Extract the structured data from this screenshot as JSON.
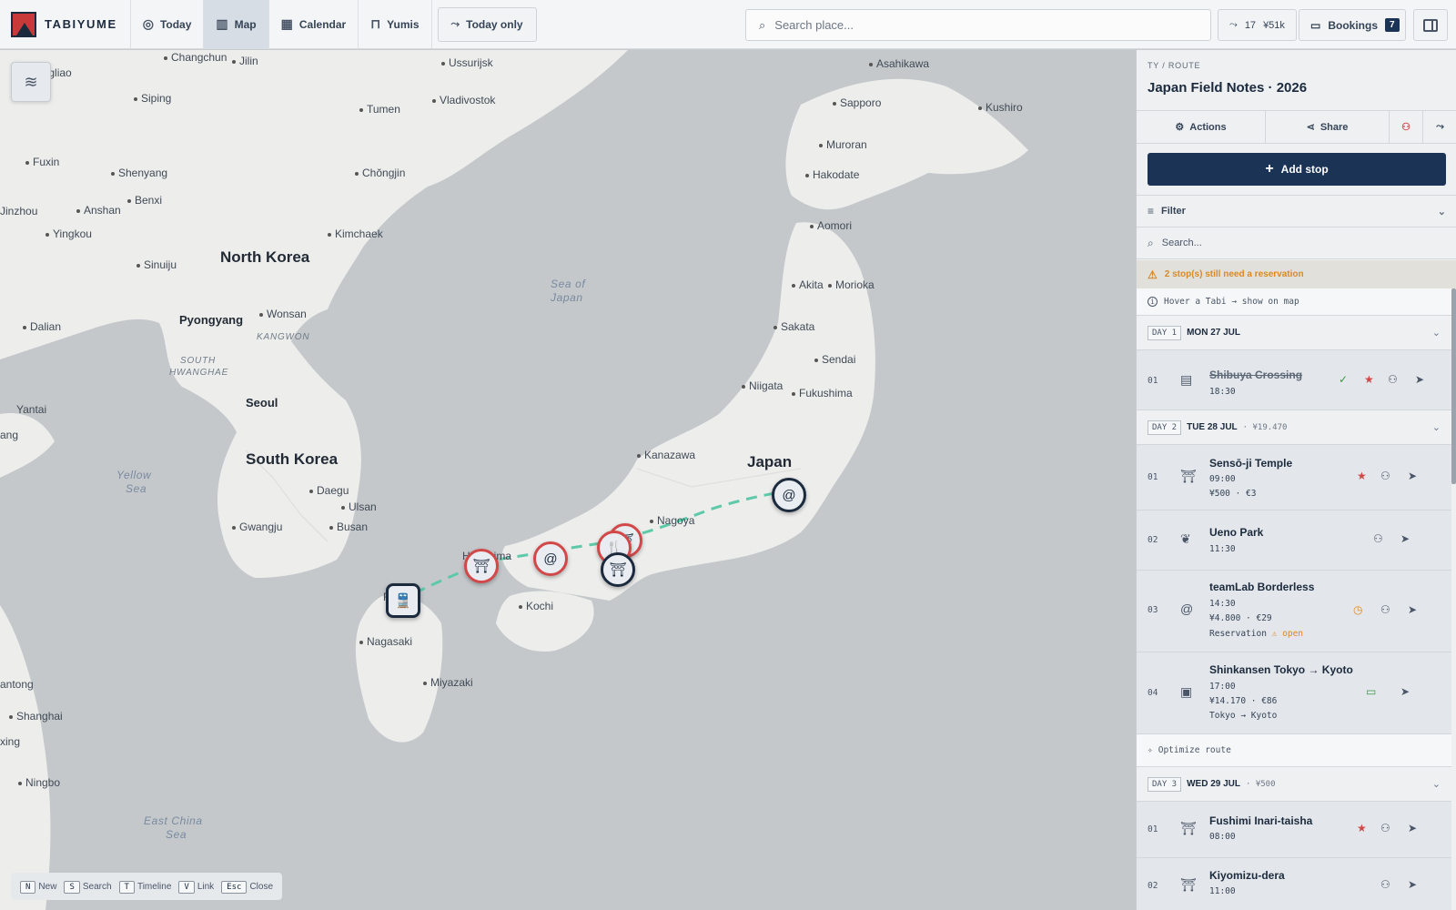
{
  "app": {
    "brand": "TABIYUME"
  },
  "nav": {
    "tabs": [
      {
        "label": "Today"
      },
      {
        "label": "Map"
      },
      {
        "label": "Calendar"
      },
      {
        "label": "Yumis"
      }
    ],
    "today_only": "Today only"
  },
  "search": {
    "placeholder": "Search place..."
  },
  "stats": {
    "stops": "17",
    "budget": "¥51k"
  },
  "bookings": {
    "label": "Bookings",
    "count": "7"
  },
  "map": {
    "labels": {
      "yongliao": "ongliao",
      "changchun": "Changchun",
      "jilin": "Jilin",
      "ussurijsk": "Ussurijsk",
      "asahikawa": "Asahikawa",
      "siping": "Siping",
      "vladivostok": "Vladivostok",
      "sapporo": "Sapporo",
      "kushiro": "Kushiro",
      "tumen": "Tumen",
      "muroran": "Muroran",
      "fuxin": "Fuxin",
      "shenyang": "Shenyang",
      "chongjin": "Chŏngjin",
      "hakodate": "Hakodate",
      "benxi": "Benxi",
      "jinzhou": "Jinzhou",
      "anshan": "Anshan",
      "aomori": "Aomori",
      "yingkou": "Yingkou",
      "kimchaek": "Kimchaek",
      "north_korea": "North Korea",
      "sinuiju": "Sinuiju",
      "sea_of_japan_1": "Sea of",
      "sea_of_japan_2": "Japan",
      "akita": "Akita",
      "morioka": "Morioka",
      "dalian": "Dalian",
      "pyongyang": "Pyongyang",
      "wonsan": "Wonsan",
      "sakata": "Sakata",
      "kangwon": "KANGWON",
      "south_hwanghae_1": "SOUTH",
      "south_hwanghae_2": "HWANGHAE",
      "sendai": "Sendai",
      "niigata": "Niigata",
      "seoul": "Seoul",
      "fukushima": "Fukushima",
      "yantai": "Yantai",
      "weifang": "ang",
      "kanazawa": "Kanazawa",
      "japan": "Japan",
      "south_korea": "South Korea",
      "yellow_sea_1": "Yellow",
      "yellow_sea_2": "Sea",
      "daegu": "Daegu",
      "ulsan": "Ulsan",
      "nagoya": "Nagoya",
      "gwangju": "Gwangju",
      "busan": "Busan",
      "hiroshima": "Hiroshima",
      "kochi": "Kochi",
      "fukuoka": "F",
      "nagasaki": "Nagasaki",
      "nantong": "antong",
      "miyazaki": "Miyazaki",
      "shanghai": "Shanghai",
      "huzhou": "xing",
      "ningbo": "Ningbo",
      "east_china_sea_1": "East China",
      "east_china_sea_2": "Sea"
    },
    "shortcuts": [
      {
        "key": "N",
        "label": "New"
      },
      {
        "key": "S",
        "label": "Search"
      },
      {
        "key": "T",
        "label": "Timeline"
      },
      {
        "key": "V",
        "label": "Link"
      },
      {
        "key": "Esc",
        "label": "Close"
      }
    ]
  },
  "panel": {
    "breadcrumb": "TY / ROUTE",
    "title": "Japan Field Notes · 2026",
    "actions_label": "Actions",
    "share_label": "Share",
    "add_stop_label": "Add stop",
    "filter_label": "Filter",
    "search_placeholder": "Search...",
    "warning": "2 stop(s) still need a reservation",
    "hint": "Hover a Tabi → show on map",
    "optimize_label": "Optimize route",
    "days": [
      {
        "tag": "DAY 1",
        "date": "MON 27 JUL",
        "cost": "",
        "stops": [
          {
            "num": "01",
            "name": "Shibuya Crossing",
            "time": "18:30",
            "done": true
          }
        ]
      },
      {
        "tag": "DAY 2",
        "date": "TUE 28 JUL",
        "cost": "· ¥19.470",
        "stops": [
          {
            "num": "01",
            "name": "Sensō-ji Temple",
            "time": "09:00",
            "price": "¥500 · €3"
          },
          {
            "num": "02",
            "name": "Ueno Park",
            "time": "11:30"
          },
          {
            "num": "03",
            "name": "teamLab Borderless",
            "time": "14:30",
            "price": "¥4.800 · €29",
            "reservation": "Reservation",
            "reservation_status": "open"
          },
          {
            "num": "04",
            "name": "Shinkansen Tokyo → Kyoto",
            "time": "17:00",
            "price": "¥14.170 · €86",
            "route": "Tokyo → Kyoto"
          }
        ]
      },
      {
        "tag": "DAY 3",
        "date": "WED 29 JUL",
        "cost": "· ¥500",
        "stops": [
          {
            "num": "01",
            "name": "Fushimi Inari-taisha",
            "time": "08:00"
          },
          {
            "num": "02",
            "name": "Kiyomizu-dera",
            "time": "11:00"
          }
        ]
      }
    ]
  },
  "colors": {
    "accent": "#1b3355",
    "marker_red": "#d24848",
    "route": "#5ec9a8",
    "warning": "#d98a24",
    "star": "#d24848",
    "check": "#3a9a4a"
  }
}
